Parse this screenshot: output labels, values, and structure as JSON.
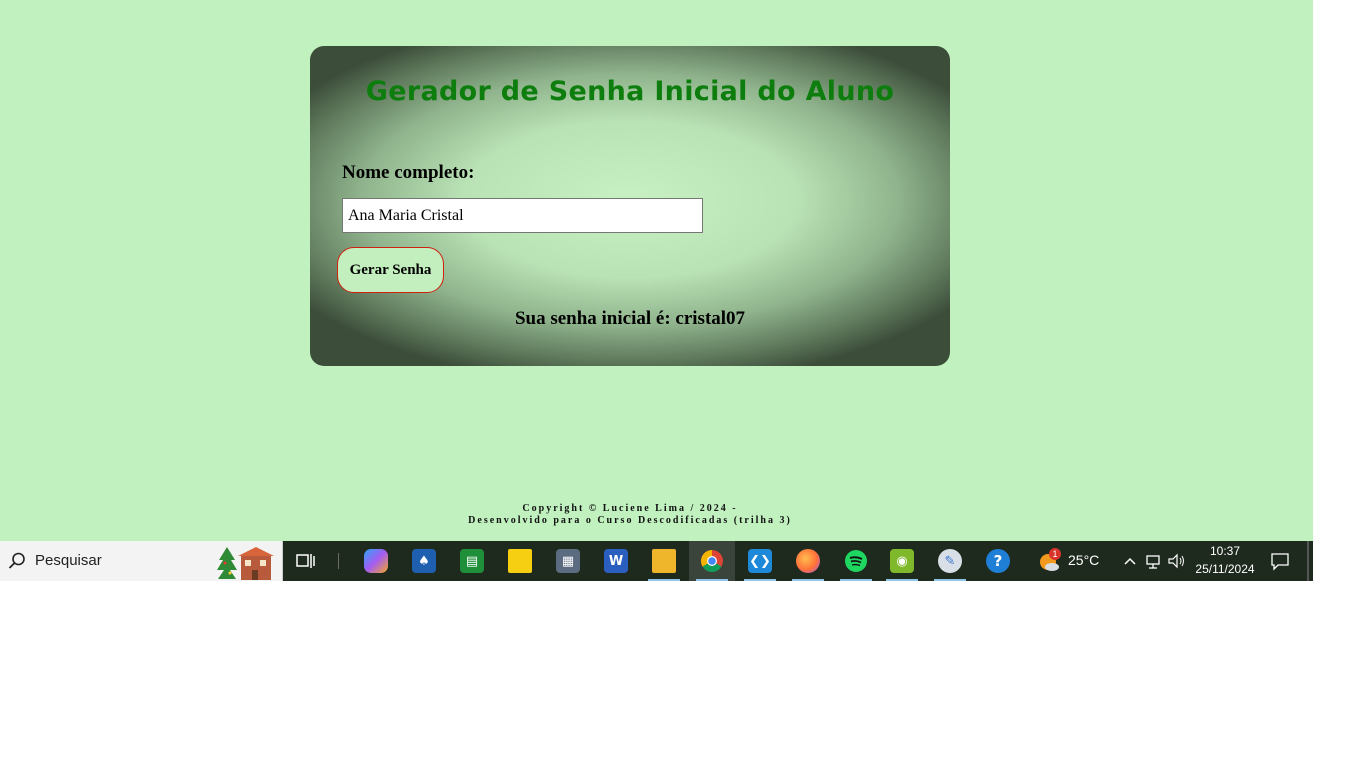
{
  "app": {
    "title": "Gerador de Senha Inicial do Aluno",
    "name_label": "Nome completo:",
    "name_value": "Ana Maria Cristal",
    "button_label": "Gerar Senha",
    "result_text": "Sua senha inicial é: cristal07"
  },
  "footer": {
    "line1": "Copyright © Luciene Lima / 2024 -",
    "line2": "Desenvolvido para o Curso Descodificadas (trilha 3)"
  },
  "taskbar": {
    "search_placeholder": "Pesquisar",
    "apps": [
      {
        "name": "task-view",
        "icon": "task-view-icon"
      },
      {
        "name": "copilot",
        "icon": "copilot-icon"
      },
      {
        "name": "solitaire",
        "icon": "solitaire-icon"
      },
      {
        "name": "google-sheets",
        "icon": "sheets-icon"
      },
      {
        "name": "sticky-notes",
        "icon": "sticky-notes-icon"
      },
      {
        "name": "calculator",
        "icon": "calculator-icon"
      },
      {
        "name": "word",
        "icon": "word-icon"
      },
      {
        "name": "file-explorer",
        "icon": "folder-icon"
      },
      {
        "name": "chrome",
        "icon": "chrome-icon"
      },
      {
        "name": "vscode",
        "icon": "vscode-icon"
      },
      {
        "name": "firefox",
        "icon": "firefox-icon"
      },
      {
        "name": "spotify",
        "icon": "spotify-icon"
      },
      {
        "name": "game-app",
        "icon": "game-controller-icon"
      },
      {
        "name": "paint",
        "icon": "paint-palette-icon"
      },
      {
        "name": "help",
        "icon": "help-icon"
      }
    ],
    "weather_badge": "1",
    "weather_temp": "25°C",
    "clock_time": "10:37",
    "clock_date": "25/11/2024"
  },
  "colors": {
    "page_bg": "#c0f1bf",
    "title_green": "#0d7d0d",
    "button_border": "#d02010",
    "taskbar_bg": "#1f2a1f"
  }
}
